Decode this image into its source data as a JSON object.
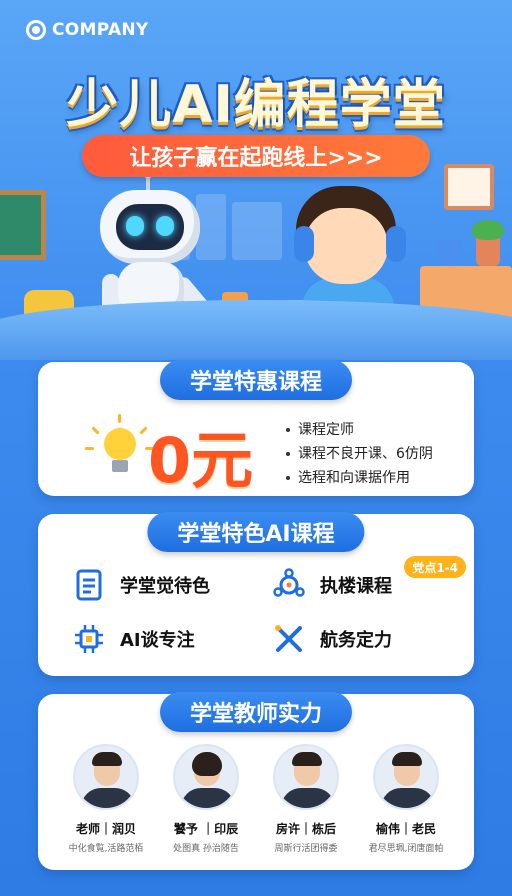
{
  "brand": {
    "logo_text": "COMPANY"
  },
  "hero": {
    "title": "少儿AI编程学堂",
    "subtitle": "让孩子赢在起跑线上>>>"
  },
  "offer": {
    "heading": "学堂特惠课程",
    "price": "0元",
    "bullets": [
      "课程定师",
      "课程不良开课、6仿阴",
      "选程和向课据作用"
    ]
  },
  "features": {
    "heading": "学堂特色AI课程",
    "badge": "党点1-4",
    "items": [
      {
        "label": "学堂觉待色",
        "icon": "document-icon"
      },
      {
        "label": "执楼课程",
        "icon": "gear-network-icon"
      },
      {
        "label": "AI谈专注",
        "icon": "chip-icon"
      },
      {
        "label": "航务定力",
        "icon": "cross-tools-icon"
      }
    ]
  },
  "teachers": {
    "heading": "学堂教师实力",
    "list": [
      {
        "name": "老师｜润贝",
        "desc": "中化食覧,活路范栢"
      },
      {
        "name": "饕予 ｜印辰",
        "desc": "处图真 孙治随告"
      },
      {
        "name": "房许｜栋后",
        "desc": "周斯行活团得委"
      },
      {
        "name": "榆伟｜老民",
        "desc": "君尽思珮,闭唐面帕"
      }
    ]
  },
  "colors": {
    "accent": "#2e7ce4",
    "price": "#ff5520",
    "subtitle_bg": "#ff5a3c",
    "badge": "#ffb21a"
  }
}
